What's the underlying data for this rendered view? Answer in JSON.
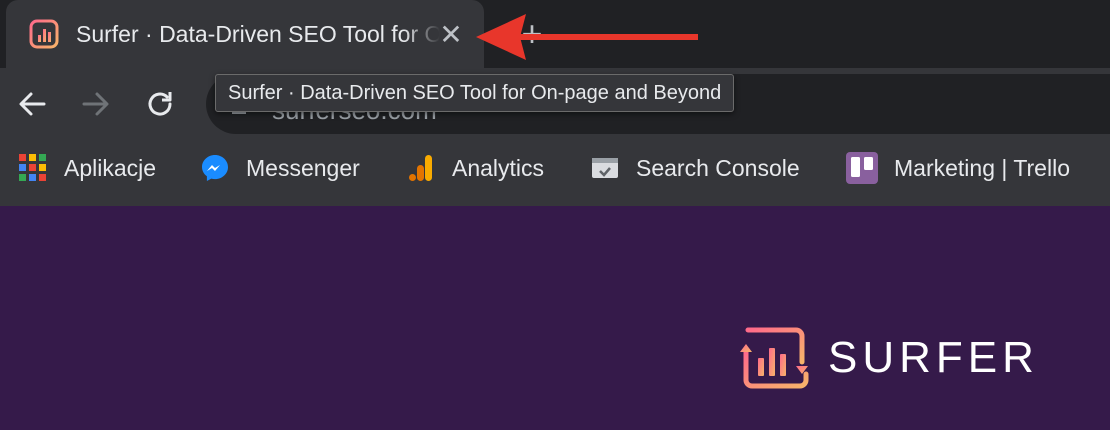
{
  "tab": {
    "title": "Surfer · Data-Driven SEO Tool for On-page and Beyond",
    "close_icon": "✕",
    "new_tab_icon": "+"
  },
  "tooltip": {
    "text": "Surfer · Data-Driven SEO Tool for On-page and Beyond"
  },
  "toolbar": {
    "back_icon": "arrow-left-icon",
    "forward_icon": "arrow-right-icon",
    "reload_icon": "reload-icon",
    "address": "surferseo.com"
  },
  "bookmarks": [
    {
      "label": "Aplikacje",
      "icon": "apps-grid-icon"
    },
    {
      "label": "Messenger",
      "icon": "messenger-icon"
    },
    {
      "label": "Analytics",
      "icon": "analytics-icon"
    },
    {
      "label": "Search Console",
      "icon": "search-console-icon"
    },
    {
      "label": "Marketing | Trello",
      "icon": "trello-icon"
    }
  ],
  "page": {
    "brand": "SURFER",
    "background": "#351a4a"
  },
  "colors": {
    "annotation_arrow": "#e8362b",
    "brand_gradient_start": "#ff6a6a",
    "brand_gradient_end": "#f7b46a"
  }
}
